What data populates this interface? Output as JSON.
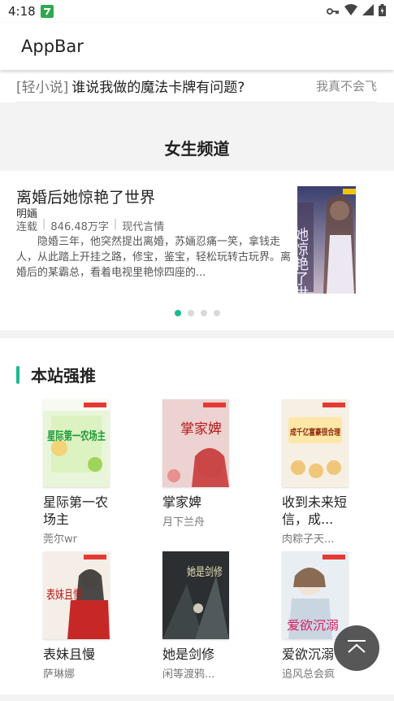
{
  "status_bar": {
    "time": "4:18",
    "icons": [
      "notification-badge-icon",
      "vpn-key-icon",
      "wifi-icon",
      "cell-signal-icon",
      "battery-icon"
    ]
  },
  "app_bar": {
    "title": "AppBar"
  },
  "light_novel": {
    "tag": "[轻小说]",
    "title": "谁说我做的魔法卡牌有问题?",
    "author": "我真不会飞"
  },
  "girls_channel": {
    "title": "女生频道",
    "featured": {
      "title": "离婚后她惊艳了世界",
      "author": "明婳",
      "status": "连载",
      "word_count": "846.48万字",
      "genre": "现代言情",
      "description": "隐婚三年，他突然提出离婚，苏婳忍痛一笑，拿钱走人，从此踏上开挂之路，修宝，鉴宝，轻松玩转古玩界。离婚后的某霸总，看着电视里艳惊四座的...",
      "cover_text": "她惊艳了世界"
    },
    "carousel": {
      "total": 4,
      "active": 1
    }
  },
  "recommend": {
    "title": "本站强推",
    "books": [
      {
        "title": "星际第一农场主",
        "author": "莞尔wr",
        "cover_text": "星际第一农场主"
      },
      {
        "title": "掌家婢",
        "author": "月下兰舟",
        "cover_text": "掌家婢"
      },
      {
        "title": "收到未来短信，成...",
        "author": "肉粽子天...",
        "cover_text": "成千亿富豪很合理"
      },
      {
        "title": "表妹且慢",
        "author": "萨琳娜",
        "cover_text": "表妹且慢"
      },
      {
        "title": "她是剑修",
        "author": "闲等渡鸦...",
        "cover_text": "她是剑修"
      },
      {
        "title": "爱欲沉溺",
        "author": "追风总会疯",
        "cover_text": "爱欲沉溺"
      }
    ]
  },
  "colors": {
    "accent": "#1cb98f",
    "background_band": "#f3f3f3",
    "fab": "#323232"
  }
}
